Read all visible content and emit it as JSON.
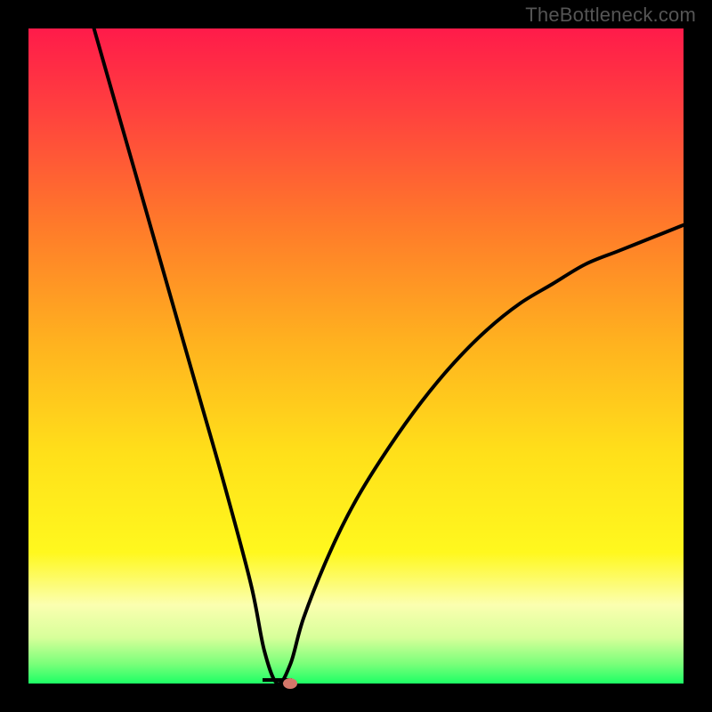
{
  "watermark": "TheBottleneck.com",
  "colors": {
    "gradient_stops": [
      {
        "offset": "0%",
        "color": "#ff1b4a"
      },
      {
        "offset": "12%",
        "color": "#ff3f3f"
      },
      {
        "offset": "30%",
        "color": "#ff7a2a"
      },
      {
        "offset": "48%",
        "color": "#ffb21f"
      },
      {
        "offset": "65%",
        "color": "#ffe01a"
      },
      {
        "offset": "80%",
        "color": "#fff81e"
      },
      {
        "offset": "88%",
        "color": "#fbffb0"
      },
      {
        "offset": "93%",
        "color": "#d7ff9a"
      },
      {
        "offset": "97%",
        "color": "#7aff7a"
      },
      {
        "offset": "100%",
        "color": "#1dff65"
      }
    ],
    "curve_stroke": "#000000",
    "marker_fill": "#d4776a",
    "page_bg": "#000000"
  },
  "chart_data": {
    "type": "line",
    "title": "",
    "xlabel": "",
    "ylabel": "",
    "xlim": [
      0,
      100
    ],
    "ylim": [
      0,
      100
    ],
    "grid": false,
    "legend": false,
    "annotations": [
      "TheBottleneck.com"
    ],
    "description": "V-shaped bottleneck curve over vertical rainbow gradient (red top → green bottom). Minimum ≈0 occurs around x≈38. Left branch starts near (10,100) and descends steeply; right branch rises with diminishing slope toward ≈70 at x=100. Almost no axis/tick labels are rendered.",
    "series": [
      {
        "name": "bottleneck-curve",
        "x": [
          10,
          14,
          18,
          22,
          26,
          30,
          34,
          36,
          38,
          40,
          42,
          46,
          50,
          55,
          60,
          65,
          70,
          75,
          80,
          85,
          90,
          95,
          100
        ],
        "values": [
          100,
          86,
          72,
          58,
          44,
          30,
          15,
          5,
          0,
          3,
          10,
          20,
          28,
          36,
          43,
          49,
          54,
          58,
          61,
          64,
          66,
          68,
          70
        ]
      }
    ],
    "marker": {
      "x": 40,
      "y": 0
    }
  }
}
